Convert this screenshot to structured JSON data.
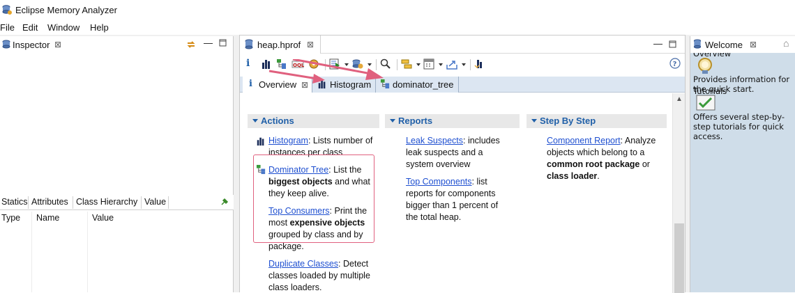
{
  "app": {
    "title": "Eclipse Memory Analyzer"
  },
  "menu": [
    "File",
    "Edit",
    "Window",
    "Help"
  ],
  "inspector": {
    "tab_label": "Inspector",
    "subtabs": [
      "Statics",
      "Attributes",
      "Class Hierarchy",
      "Value"
    ],
    "columns": [
      "Type",
      "Name",
      "Value"
    ]
  },
  "editor": {
    "tab_label": "heap.hprof",
    "subtabs": [
      "Overview",
      "Histogram",
      "dominator_tree"
    ],
    "sections": {
      "actions": {
        "title": "Actions",
        "items": [
          {
            "link": "Histogram",
            "text": ": Lists number of instances per class"
          },
          {
            "link": "Dominator Tree",
            "text_before": ": List the ",
            "bold": "biggest objects",
            "text_after": " and what they keep alive."
          },
          {
            "link": "Top Consumers",
            "text_before": ": Print the most ",
            "bold": "expensive objects",
            "text_after": " grouped by class and by package."
          },
          {
            "link": "Duplicate Classes",
            "text": ": Detect classes loaded by multiple class loaders."
          }
        ]
      },
      "reports": {
        "title": "Reports",
        "items": [
          {
            "link": "Leak Suspects",
            "text": ": includes leak suspects and a system overview"
          },
          {
            "link": "Top Components",
            "text": ": list reports for components bigger than 1 percent of the total heap."
          }
        ]
      },
      "step": {
        "title": "Step By Step",
        "items": [
          {
            "link": "Component Report",
            "text_before": ": Analyze objects which belong to a ",
            "bold1": "common root package",
            "text_mid": " or ",
            "bold2": "class loader",
            "text_after": "."
          }
        ]
      }
    }
  },
  "welcome": {
    "tab_label": "Welcome",
    "overview_label": "Overview",
    "overview_desc": "Provides information for the quick start.",
    "tutorials_label": "Tutorials",
    "tutorials_desc": "Offers several step-by-step tutorials for quick access."
  },
  "colors": {
    "link": "#1e4fd0",
    "section_title": "#1f5fa8",
    "annotation": "#e0607e"
  }
}
